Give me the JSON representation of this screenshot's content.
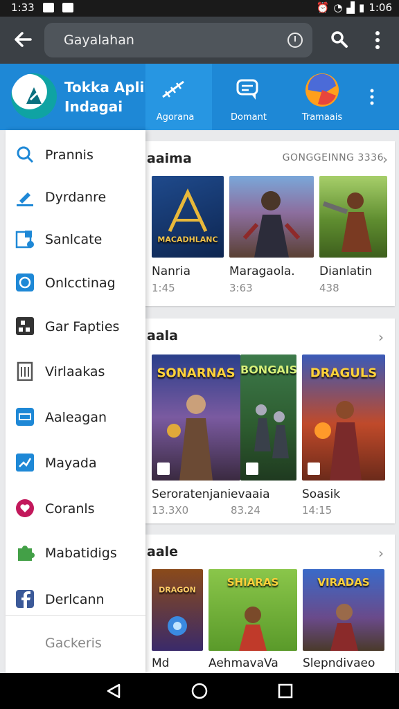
{
  "status_bar": {
    "time_left": "1:33",
    "time_right": "1:06"
  },
  "search": {
    "value": "Gayalahan"
  },
  "app": {
    "title": "Tokka Aplikasi Indagai"
  },
  "tabs": [
    {
      "label": "Agorana",
      "icon": "ruler-icon"
    },
    {
      "label": "Domant",
      "icon": "chat-icon"
    },
    {
      "label": "Tramaais",
      "icon": "globe-icon"
    }
  ],
  "drawer": {
    "items": [
      {
        "label": "Prannis",
        "icon": "search-icon",
        "color": "#1e88d6"
      },
      {
        "label": "Dyrdanre",
        "icon": "edit-icon",
        "color": "#1e88d6"
      },
      {
        "label": "Sanlcate",
        "icon": "device-icon",
        "color": "#1e88d6"
      },
      {
        "label": "Onlcctinag",
        "icon": "circle-badge-icon",
        "color": "#1e88d6"
      },
      {
        "label": "Gar Fapties",
        "icon": "grid-icon",
        "color": "#333333"
      },
      {
        "label": "Virlaakas",
        "icon": "document-icon",
        "color": "#555555"
      },
      {
        "label": "Aaleagan",
        "icon": "card-icon",
        "color": "#1e88d6"
      },
      {
        "label": "Mayada",
        "icon": "chart-icon",
        "color": "#1e88d6"
      },
      {
        "label": "Coranls",
        "icon": "heart-icon",
        "color": "#c2185b"
      },
      {
        "label": "Mabatidigs",
        "icon": "puzzle-icon",
        "color": "#43a047"
      },
      {
        "label": "Derlcann",
        "icon": "facebook-icon",
        "color": "#3b5998"
      }
    ],
    "footer": "Gackeris"
  },
  "sections": [
    {
      "title": "aaima",
      "more": "GONGGEINNG 3336",
      "games": [
        {
          "name": "Nanria",
          "size": "1:45",
          "tile_text": "MACADHLANC"
        },
        {
          "name": "Maragaola.",
          "size": "3:63",
          "tile_text": ""
        },
        {
          "name": "Dianlatin",
          "size": "438",
          "tile_text": ""
        }
      ]
    },
    {
      "title": "aala",
      "games": [
        {
          "name": "Seroratenjani",
          "size": "13.3X0",
          "tile_text": "SONARNAS"
        },
        {
          "name": "evaaia",
          "size": "83.24",
          "tile_text": "BONGAIS"
        },
        {
          "name": "Soasik",
          "size": "14:15",
          "tile_text": "DRAGULS"
        }
      ]
    },
    {
      "title": "aale",
      "games": [
        {
          "name": "Md",
          "size": "",
          "tile_text": "DRAGON"
        },
        {
          "name": "AehmavaVa",
          "size": "",
          "tile_text": "SHIARAS"
        },
        {
          "name": "Slepndivaeo",
          "size": "",
          "tile_text": "VIRADAS"
        }
      ]
    }
  ],
  "colors": {
    "appbar": "#3b4045",
    "accent": "#1e88d6"
  }
}
